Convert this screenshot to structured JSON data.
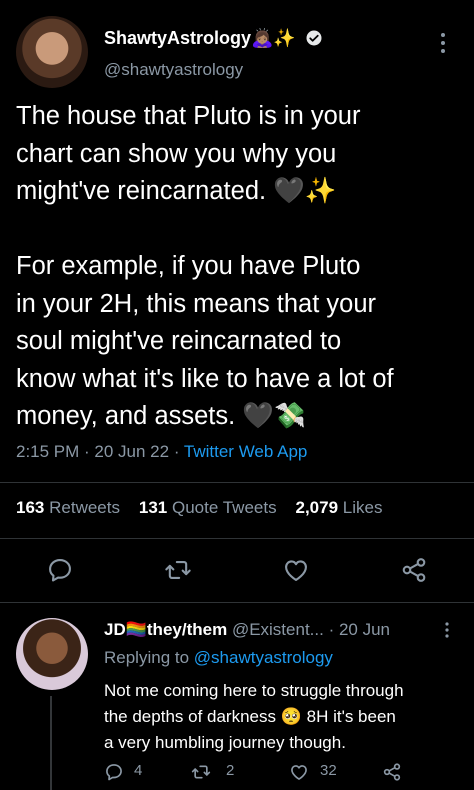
{
  "tweet": {
    "display_name": "ShawtyAstrology🙇🏽‍♀️✨",
    "handle": "@shawtyastrology",
    "text": "The house that Pluto is in your\nchart can show you why you\nmight've reincarnated. 🖤✨\n\nFor example, if you have Pluto\nin your 2H, this means that your\nsoul might've reincarnated to\nknow what it's like to have a lot of\nmoney, and assets. 🖤💸",
    "time": "2:15 PM · 20 Jun 22 · ",
    "source": "Twitter Web App",
    "retweets_count": "163",
    "retweets_label": "Retweets",
    "quotes_count": "131",
    "quotes_label": "Quote Tweets",
    "likes_count": "2,079",
    "likes_label": "Likes"
  },
  "reply": {
    "display_name": "JD🏳️‍🌈they/them",
    "handle": "@Existent...",
    "date": "· 20 Jun",
    "replying_label": "Replying to ",
    "replying_to": "@shawtyastrology",
    "text": "Not me coming here to struggle through\nthe depths of darkness 🥺 8H it's been\na very humbling journey though.",
    "reply_count": "4",
    "retweet_count": "2",
    "like_count": "32"
  },
  "colors": {
    "background": "#000000",
    "muted": "#8b98a5",
    "link": "#1d9bf0",
    "divider": "#2f3336"
  },
  "icons": [
    "reply-icon",
    "retweet-icon",
    "like-icon",
    "share-icon",
    "verified-icon",
    "more-icon"
  ]
}
